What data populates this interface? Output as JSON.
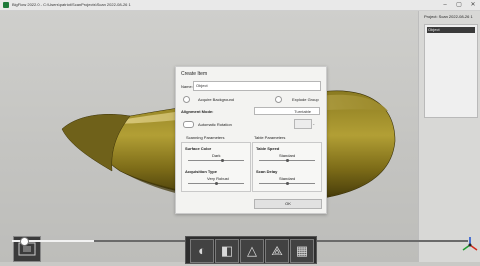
{
  "window": {
    "title": "BigFlow 2022.0 - C:\\Users\\patriot\\ScanProjects\\Scan 2022-08-26 1"
  },
  "project_panel": {
    "title": "Project: Scan 2022-08-26 1",
    "items": [
      {
        "label": "Object"
      }
    ]
  },
  "dialog": {
    "title": "Create Item",
    "name_label": "Name:",
    "name_value": "Object",
    "acquire_background_label": "Acquire Background",
    "explode_group_label": "Explode Group",
    "alignment_mode_label": "Alignment Mode:",
    "alignment_mode_value": "Turntable",
    "automatic_rotation_label": "Automatic Rotation",
    "scanning_parameters_label": "Scanning Parameters",
    "table_parameters_label": "Table Parameters",
    "surface_color_label": "Surface Color",
    "surface_color_value": "Dark",
    "acquisition_type_label": "Acquisition Type",
    "acquisition_type_value": "Very Robust",
    "table_speed_label": "Table Speed",
    "table_speed_value": "Standard",
    "scan_delay_label": "Scan Delay",
    "scan_delay_value": "Standard",
    "ok_label": "OK",
    "sliders": {
      "surface_color": 0.62,
      "acquisition_type": 0.5,
      "table_speed": 0.5,
      "scan_delay": 0.5
    }
  },
  "bottom": {
    "progress": 0.18
  },
  "colors": {
    "object_fill": "#a38f2a",
    "object_shadow": "#4a3f10",
    "background": "#c9c9c6"
  }
}
